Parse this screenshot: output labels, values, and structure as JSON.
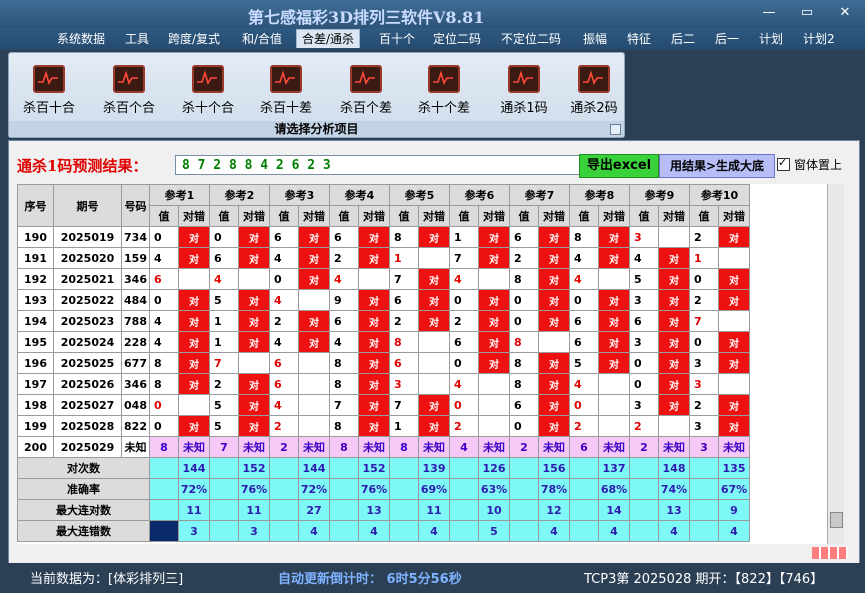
{
  "app": {
    "title": "第七感福彩3D排列三软件V8.81"
  },
  "window_controls": {
    "minimize": "—",
    "maximize": "▭",
    "close": "✕"
  },
  "menu": [
    "系统数据",
    "工具",
    "跨度/复式",
    "和/合值",
    "合差/通杀",
    "百十个",
    "定位二码",
    "不定位二码",
    "振幅",
    "特征",
    "后二",
    "后一",
    "计划",
    "计划2"
  ],
  "ribbon": {
    "buttons": [
      "杀百十合",
      "杀百个合",
      "杀十个合",
      "杀百十差",
      "杀百个差",
      "杀十个差",
      "通杀1码",
      "通杀2码"
    ],
    "footer": "请选择分析项目"
  },
  "result": {
    "label": "通杀1码预测结果：",
    "value": "8 7 2 8 8 4 2 6 2 3",
    "excel_btn": "导出excel",
    "gen_btn": "用结果>生成大底",
    "checkbox_label": "窗体置上"
  },
  "table": {
    "h_seq": "序号",
    "h_period": "期号",
    "h_code": "号码",
    "refs": [
      "参考1",
      "参考2",
      "参考3",
      "参考4",
      "参考5",
      "参考6",
      "参考7",
      "参考8",
      "参考9",
      "参考10"
    ],
    "sub_val": "值",
    "sub_right": "对错",
    "hit_text": "对",
    "unknown_text": "未知",
    "rows": [
      {
        "seq": "190",
        "period": "2025019",
        "code": "734",
        "cells": [
          [
            "0",
            1
          ],
          [
            "0",
            1
          ],
          [
            "6",
            1
          ],
          [
            "6",
            1
          ],
          [
            "8",
            1
          ],
          [
            "1",
            1
          ],
          [
            "6",
            1
          ],
          [
            "8",
            1
          ],
          [
            "3",
            0,
            1
          ],
          [
            "2",
            1
          ]
        ]
      },
      {
        "seq": "191",
        "period": "2025020",
        "code": "159",
        "cells": [
          [
            "4",
            1
          ],
          [
            "6",
            1
          ],
          [
            "4",
            1
          ],
          [
            "2",
            1
          ],
          [
            "1",
            0,
            1
          ],
          [
            "7",
            1
          ],
          [
            "2",
            1
          ],
          [
            "4",
            1
          ],
          [
            "4",
            1
          ],
          [
            "1",
            0,
            1
          ]
        ]
      },
      {
        "seq": "192",
        "period": "2025021",
        "code": "346",
        "cells": [
          [
            "6",
            0,
            1
          ],
          [
            "4",
            0,
            1
          ],
          [
            "0",
            1
          ],
          [
            "4",
            0,
            1
          ],
          [
            "7",
            1
          ],
          [
            "4",
            0,
            1
          ],
          [
            "8",
            1
          ],
          [
            "4",
            0,
            1
          ],
          [
            "5",
            1
          ],
          [
            "0",
            1
          ]
        ]
      },
      {
        "seq": "193",
        "period": "2025022",
        "code": "484",
        "cells": [
          [
            "0",
            1
          ],
          [
            "5",
            1
          ],
          [
            "4",
            0,
            1
          ],
          [
            "9",
            1
          ],
          [
            "6",
            1
          ],
          [
            "0",
            1
          ],
          [
            "0",
            1
          ],
          [
            "0",
            1
          ],
          [
            "3",
            1
          ],
          [
            "2",
            1
          ]
        ]
      },
      {
        "seq": "194",
        "period": "2025023",
        "code": "788",
        "cells": [
          [
            "4",
            1
          ],
          [
            "1",
            1
          ],
          [
            "2",
            1
          ],
          [
            "6",
            1
          ],
          [
            "2",
            1
          ],
          [
            "2",
            1
          ],
          [
            "0",
            1
          ],
          [
            "6",
            1
          ],
          [
            "6",
            1
          ],
          [
            "7",
            0,
            1
          ]
        ]
      },
      {
        "seq": "195",
        "period": "2025024",
        "code": "228",
        "cells": [
          [
            "4",
            1
          ],
          [
            "1",
            1
          ],
          [
            "4",
            1
          ],
          [
            "4",
            1
          ],
          [
            "8",
            0,
            1
          ],
          [
            "6",
            1
          ],
          [
            "8",
            0,
            1
          ],
          [
            "6",
            1
          ],
          [
            "3",
            1
          ],
          [
            "0",
            1
          ]
        ]
      },
      {
        "seq": "196",
        "period": "2025025",
        "code": "677",
        "cells": [
          [
            "8",
            1
          ],
          [
            "7",
            0,
            1
          ],
          [
            "6",
            0,
            1
          ],
          [
            "8",
            1
          ],
          [
            "6",
            0,
            1
          ],
          [
            "0",
            1
          ],
          [
            "8",
            1
          ],
          [
            "5",
            1
          ],
          [
            "0",
            1
          ],
          [
            "3",
            1
          ]
        ]
      },
      {
        "seq": "197",
        "period": "2025026",
        "code": "346",
        "cells": [
          [
            "8",
            1
          ],
          [
            "2",
            1
          ],
          [
            "6",
            0,
            1
          ],
          [
            "8",
            1
          ],
          [
            "3",
            0,
            1
          ],
          [
            "4",
            0,
            1
          ],
          [
            "8",
            1
          ],
          [
            "4",
            0,
            1
          ],
          [
            "0",
            1
          ],
          [
            "3",
            0,
            1
          ]
        ]
      },
      {
        "seq": "198",
        "period": "2025027",
        "code": "048",
        "cells": [
          [
            "0",
            0,
            1
          ],
          [
            "5",
            1
          ],
          [
            "4",
            0,
            1
          ],
          [
            "7",
            1
          ],
          [
            "7",
            1
          ],
          [
            "0",
            0,
            1
          ],
          [
            "6",
            1
          ],
          [
            "0",
            0,
            1
          ],
          [
            "3",
            1
          ],
          [
            "2",
            1
          ]
        ]
      },
      {
        "seq": "199",
        "period": "2025028",
        "code": "822",
        "cells": [
          [
            "0",
            1
          ],
          [
            "5",
            1
          ],
          [
            "2",
            0,
            1
          ],
          [
            "8",
            1
          ],
          [
            "1",
            1
          ],
          [
            "2",
            0,
            1
          ],
          [
            "0",
            1
          ],
          [
            "2",
            0,
            1
          ],
          [
            "2",
            0,
            1
          ],
          [
            "3",
            1
          ]
        ]
      }
    ],
    "pred": {
      "seq": "200",
      "period": "2025029",
      "code": "未知",
      "vals": [
        "8",
        "7",
        "2",
        "8",
        "8",
        "4",
        "2",
        "6",
        "2",
        "3"
      ]
    },
    "stats": [
      {
        "label": "对次数",
        "vals": [
          "144",
          "152",
          "144",
          "152",
          "139",
          "126",
          "156",
          "137",
          "148",
          "135"
        ]
      },
      {
        "label": "准确率",
        "vals": [
          "72%",
          "76%",
          "72%",
          "76%",
          "69%",
          "63%",
          "78%",
          "68%",
          "74%",
          "67%"
        ]
      },
      {
        "label": "最大连对数",
        "vals": [
          "11",
          "11",
          "27",
          "13",
          "11",
          "10",
          "12",
          "14",
          "13",
          "9"
        ]
      },
      {
        "label": "最大连错数",
        "vals": [
          "3",
          "3",
          "4",
          "4",
          "4",
          "5",
          "4",
          "4",
          "4",
          "4"
        ]
      }
    ]
  },
  "statusbar": {
    "current": "当前数据为：[体彩排列三]",
    "countdown": "自动更新倒计时：  6时5分56秒",
    "latest": "TCP3第 2025028 期开：【822】【746】"
  },
  "colors": {
    "hit": "#ee1111",
    "unknown": "#f5c8f5",
    "stat": "#7ef7f7",
    "accent_red": "#e00000"
  }
}
